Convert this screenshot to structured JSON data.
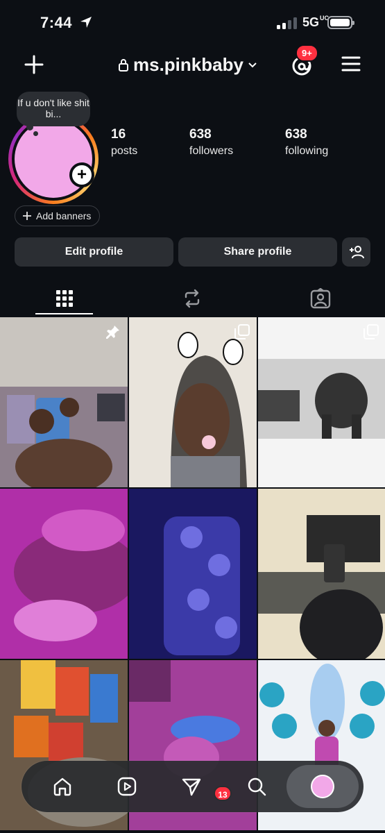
{
  "status_bar": {
    "time": "7:44",
    "network": "5G",
    "network_suffix": "UC"
  },
  "header": {
    "username": "ms.pinkbaby",
    "notification_badge": "9+"
  },
  "profile": {
    "note": "If u don't like shit bi...",
    "avatar_color": "#f2a8e8",
    "stats": [
      {
        "value": "16",
        "label": "posts"
      },
      {
        "value": "638",
        "label": "followers"
      },
      {
        "value": "638",
        "label": "following"
      }
    ]
  },
  "actions": {
    "add_banners": "Add banners",
    "edit_profile": "Edit profile",
    "share_profile": "Share profile"
  },
  "tabs": [
    {
      "icon": "grid-icon",
      "active": true
    },
    {
      "icon": "reposts-icon",
      "active": false
    },
    {
      "icon": "tagged-icon",
      "active": false
    }
  ],
  "grid": {
    "posts": [
      {
        "overlay": "pin-icon"
      },
      {
        "overlay": "carousel-icon"
      },
      {
        "overlay": "carousel-icon"
      },
      {
        "overlay": ""
      },
      {
        "overlay": ""
      },
      {
        "overlay": ""
      },
      {
        "overlay": ""
      },
      {
        "overlay": ""
      },
      {
        "overlay": ""
      }
    ]
  },
  "bottom_nav": {
    "items": [
      "home-icon",
      "reels-icon",
      "messages-icon",
      "search-icon",
      "profile-avatar"
    ],
    "messages_badge": "13"
  },
  "colors": {
    "background": "#0c0f14",
    "button": "#2b2e33",
    "badge": "#ff3040"
  }
}
